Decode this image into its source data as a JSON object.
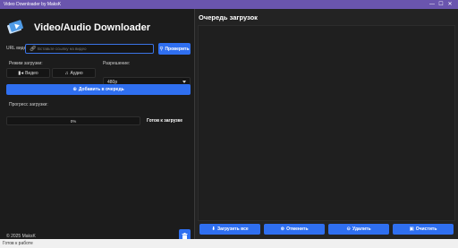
{
  "window": {
    "title": "Video Downloader by MaksK",
    "controls": [
      "—",
      "☐",
      "✕"
    ]
  },
  "header": {
    "app_title": "Video/Audio Downloader",
    "logo_icon": "download-logo-icon"
  },
  "url": {
    "label": "URL видео:",
    "placeholder": "Вставьте ссылку на видео",
    "value": "",
    "check_button": "Проверить",
    "icon": "link-icon"
  },
  "mode": {
    "label": "Режим загрузки:",
    "options": [
      "Видео",
      "Аудио"
    ],
    "selected": "Видео"
  },
  "resolution": {
    "label": "Разрешение:",
    "value": "480p"
  },
  "add_button": "Добавить в очередь",
  "progress": {
    "label": "Прогресс загрузки:",
    "percent": 0,
    "text": "0%",
    "status": "Готов к загрузке"
  },
  "footer": {
    "copyright": "© 2025 MaksK"
  },
  "queue": {
    "title": "Очередь загрузок",
    "buttons": [
      "Загрузить все",
      "Отменить",
      "Удалить",
      "Очистить"
    ],
    "items": []
  },
  "statusbar": {
    "text": "Готов к работе"
  },
  "colors": {
    "accent": "#2f6ff0",
    "titlebar": "#6a55ae",
    "background": "#1c1c1c"
  }
}
